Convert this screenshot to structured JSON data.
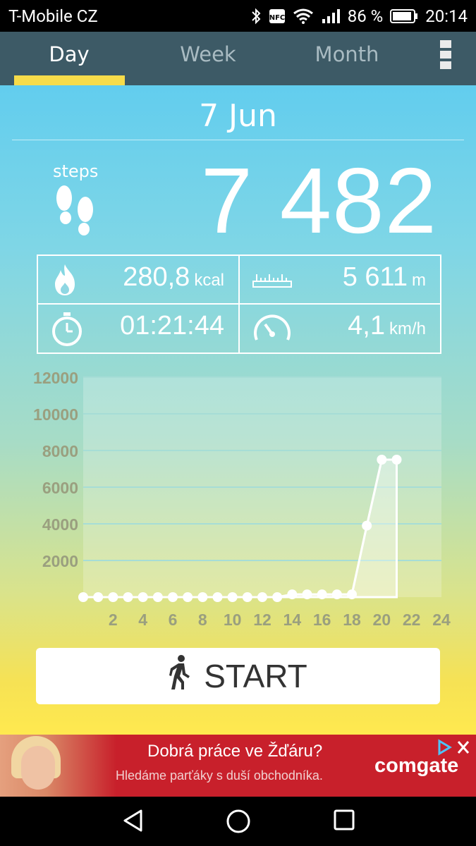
{
  "status_bar": {
    "carrier": "T-Mobile CZ",
    "battery_percent": "86 %",
    "time": "20:14"
  },
  "tabs": [
    {
      "label": "Day",
      "active": true
    },
    {
      "label": "Week",
      "active": false
    },
    {
      "label": "Month",
      "active": false
    }
  ],
  "date": "7 Jun",
  "steps": {
    "label": "steps",
    "value": "7 482"
  },
  "stats": {
    "calories": {
      "value": "280,8",
      "unit": "kcal"
    },
    "distance": {
      "value": "5 611",
      "unit": "m"
    },
    "duration": {
      "value": "01:21:44",
      "unit": ""
    },
    "speed": {
      "value": "4,1",
      "unit": "km/h"
    }
  },
  "chart_data": {
    "type": "area",
    "x": [
      0,
      1,
      2,
      3,
      4,
      5,
      6,
      7,
      8,
      9,
      10,
      11,
      12,
      13,
      14,
      15,
      16,
      17,
      18,
      19,
      20,
      21
    ],
    "values": [
      0,
      0,
      0,
      0,
      0,
      0,
      0,
      0,
      0,
      0,
      0,
      0,
      0,
      0,
      150,
      150,
      150,
      150,
      150,
      3900,
      7500,
      7500
    ],
    "y_ticks": [
      "2000",
      "4000",
      "6000",
      "8000",
      "10000",
      "12000"
    ],
    "x_ticks": [
      "2",
      "4",
      "6",
      "8",
      "10",
      "12",
      "14",
      "16",
      "18",
      "20",
      "22",
      "24"
    ],
    "xlim": [
      0,
      24
    ],
    "ylim": [
      0,
      12000
    ],
    "grid": true,
    "colors": {
      "line": "#ffffff",
      "tick": "#9a9f7f",
      "grid": "#a6ddd6"
    }
  },
  "start_button": {
    "label": "START"
  },
  "ad": {
    "title": "Dobrá práce ve Žďáru?",
    "subtitle": "Hledáme parťáky s  duší obchodníka.",
    "brand": "comgate"
  },
  "colors": {
    "tabbar": "#3d5a66",
    "accent": "#f7dc4a",
    "ad_background": "#c8202b"
  }
}
